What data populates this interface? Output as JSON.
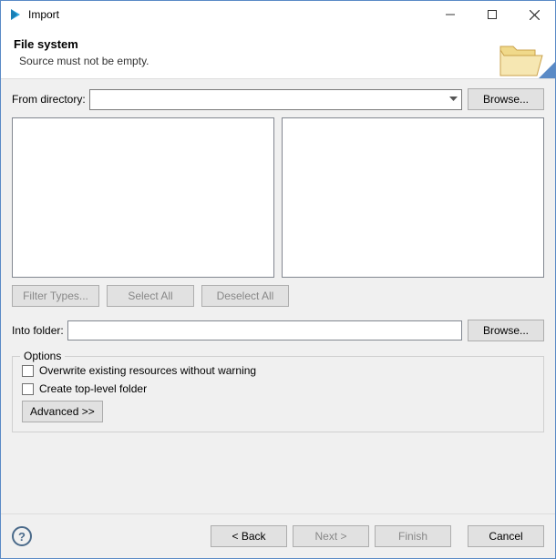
{
  "window": {
    "title": "Import"
  },
  "banner": {
    "title": "File system",
    "subtitle": "Source must not be empty."
  },
  "from_dir": {
    "label": "From directory:",
    "value": "",
    "browse": "Browse..."
  },
  "tree_buttons": {
    "filter": "Filter Types...",
    "select_all": "Select All",
    "deselect_all": "Deselect All"
  },
  "into_folder": {
    "label": "Into folder:",
    "value": "",
    "browse": "Browse..."
  },
  "options": {
    "legend": "Options",
    "overwrite": "Overwrite existing resources without warning",
    "create_top": "Create top-level folder",
    "advanced": "Advanced >>"
  },
  "wizard": {
    "back": "< Back",
    "next": "Next >",
    "finish": "Finish",
    "cancel": "Cancel"
  }
}
